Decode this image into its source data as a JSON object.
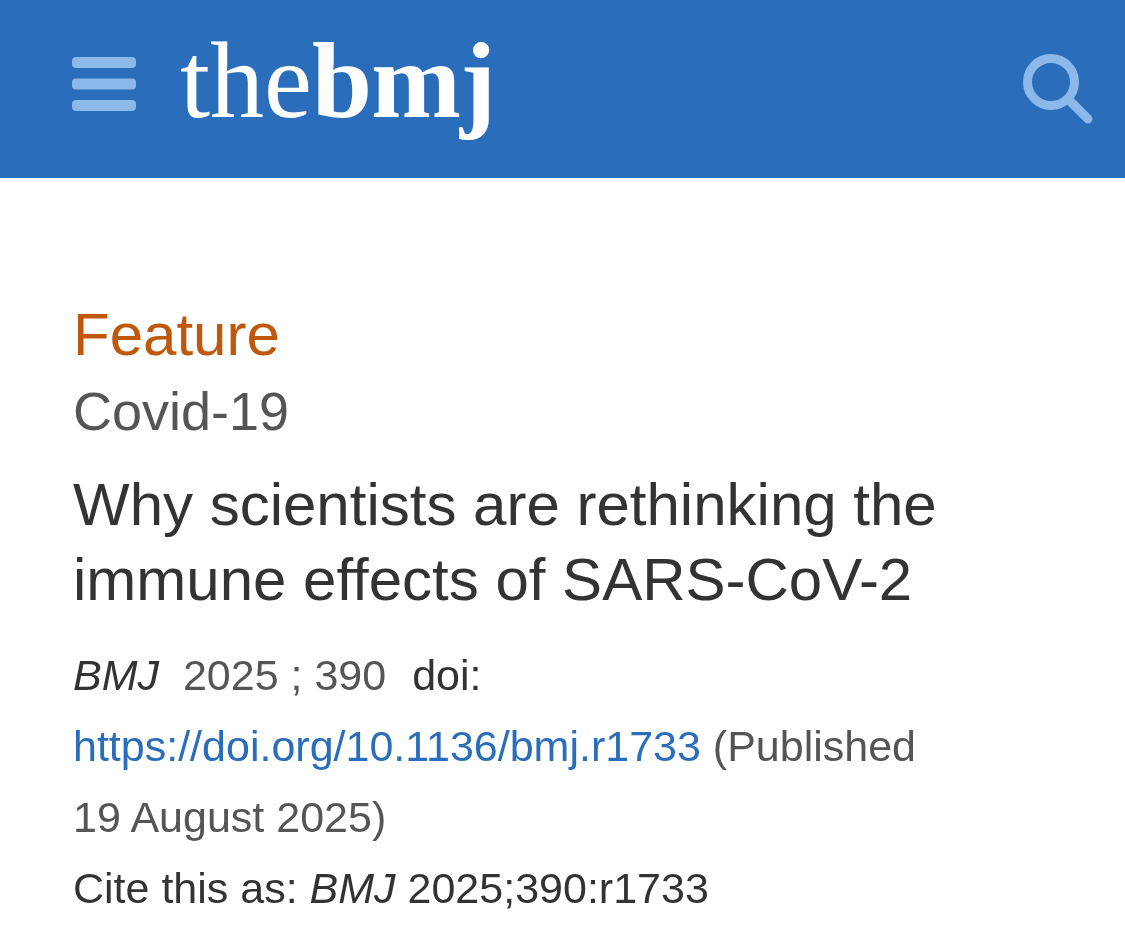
{
  "header": {
    "logo": {
      "light": "the",
      "bold": "bmj"
    }
  },
  "article": {
    "type": "Feature",
    "topic": "Covid-19",
    "title": "Why scientists are rethinking the immune effects of SARS-CoV-2",
    "citation": {
      "journal": "BMJ",
      "volume": "2025 ; 390",
      "doi_label": "doi:",
      "doi_link": "https://doi.org/10.1136/bmj.r1733",
      "published": "(Published 19 August 2025)"
    },
    "cite_as": "Cite this as: *BMJ* 2025;390:r1733"
  }
}
